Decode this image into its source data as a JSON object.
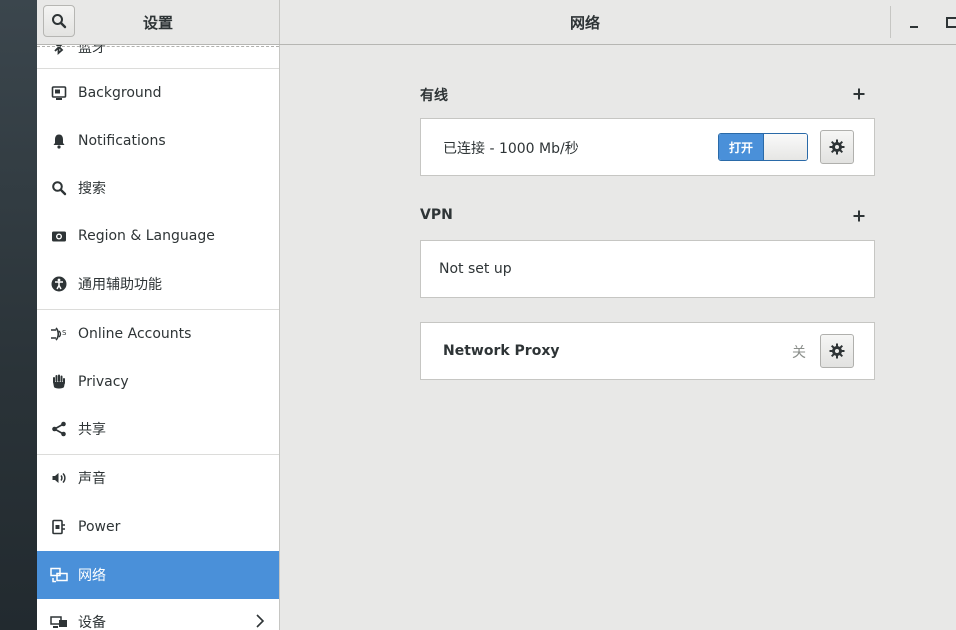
{
  "header": {
    "sidebar_title": "设置",
    "main_title": "网络",
    "search_icon": "search-icon",
    "minimize_icon": "minimize-icon",
    "maximize_icon": "maximize-icon"
  },
  "sidebar": {
    "items": [
      {
        "label": "蓝牙",
        "icon": "bluetooth-icon"
      },
      {
        "label": "Background",
        "icon": "background-icon"
      },
      {
        "label": "Notifications",
        "icon": "bell-icon"
      },
      {
        "label": "搜索",
        "icon": "search-icon"
      },
      {
        "label": "Region & Language",
        "icon": "camera-icon"
      },
      {
        "label": "通用辅助功能",
        "icon": "accessibility-icon"
      },
      {
        "label": "Online Accounts",
        "icon": "online-accounts-icon"
      },
      {
        "label": "Privacy",
        "icon": "hand-icon"
      },
      {
        "label": "共享",
        "icon": "share-icon"
      },
      {
        "label": "声音",
        "icon": "speaker-icon"
      },
      {
        "label": "Power",
        "icon": "power-plug-icon"
      },
      {
        "label": "网络",
        "icon": "network-icon",
        "selected": true
      },
      {
        "label": "设备",
        "icon": "devices-icon"
      }
    ],
    "selected_color": "#4a90d9"
  },
  "main": {
    "wired": {
      "title": "有线",
      "status": "已连接 - 1000 Mb/秒",
      "switch_label": "打开",
      "switch_on": true
    },
    "vpn": {
      "title": "VPN",
      "empty_label": "Not set up"
    },
    "proxy": {
      "label": "Network Proxy",
      "status": "关"
    }
  }
}
